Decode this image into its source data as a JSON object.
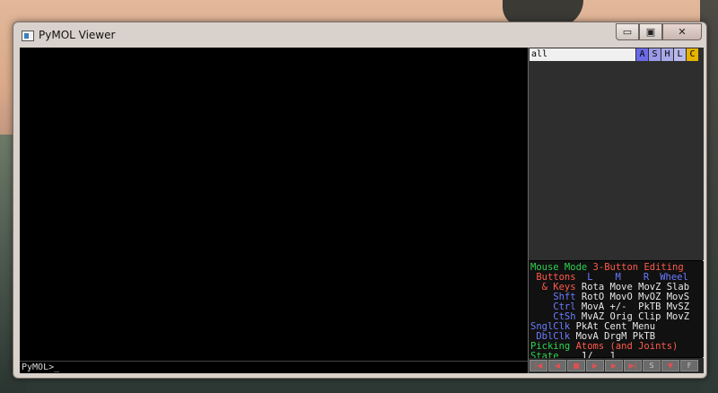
{
  "window": {
    "title": "PyMOL Viewer"
  },
  "window_controls": {
    "minimize": "▭",
    "maximize": "▣",
    "close": "✕"
  },
  "command_line": {
    "prompt": "PyMOL>",
    "cursor": "_"
  },
  "object_panel": {
    "object_name": "all",
    "buttons": [
      {
        "label": "A",
        "color": "#6b6be8"
      },
      {
        "label": "S",
        "color": "#9a9ae6"
      },
      {
        "label": "H",
        "color": "#a9a9e8"
      },
      {
        "label": "L",
        "color": "#b9b9ea"
      },
      {
        "label": "C",
        "color": "#e6b400"
      }
    ]
  },
  "mouse_mode": {
    "row1": {
      "a": "Mouse Mode ",
      "b": "3-Button Editing"
    },
    "row2": {
      "a": " Buttons  ",
      "l": "L",
      "m": "M",
      "r": "R",
      "w": "Wheel"
    },
    "row3": {
      "a": "  & Keys ",
      "b": "Rota Move MovZ Slab"
    },
    "row4": {
      "a": "    Shft ",
      "b": "RotO MovO MvOZ MovS"
    },
    "row5": {
      "a": "    Ctrl ",
      "b": "MovA +/-  PkTB MvSZ"
    },
    "row6": {
      "a": "    CtSh ",
      "b": "MvAZ Orig Clip MovZ"
    },
    "row7": {
      "a": "SnglClk ",
      "b": "PkAt Cent Menu"
    },
    "row8": {
      "a": " DblClk ",
      "b": "MovA DrgM PkTB"
    },
    "row9": {
      "a": "Picking ",
      "b": "Atoms (and Joints)"
    },
    "row10": {
      "a": "State ",
      "b": "   1/   1"
    }
  },
  "transport": {
    "buttons": [
      "|◀",
      "◀",
      "■",
      "▶",
      "▶",
      "▶|",
      "S",
      "▼",
      "F"
    ]
  }
}
